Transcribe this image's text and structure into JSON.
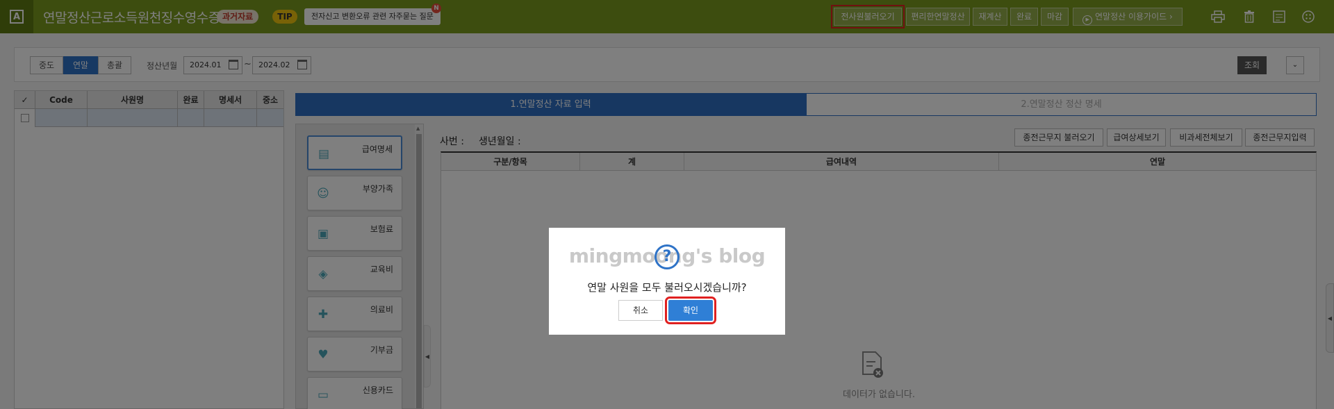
{
  "header": {
    "logo": "A",
    "title": "연말정산근로소득원천징수영수증",
    "past_badge": "과거자료",
    "tip_badge": "TIP",
    "tip_text": "전자신고 변환오류 관련 자주묻는 질문",
    "new_badge": "N",
    "buttons": {
      "load_all": "전사원불러오기",
      "simple_settlement": "편리한연말정산",
      "recalc": "재계산",
      "complete": "완료",
      "close": "마감",
      "guide": "연말정산 이용가이드"
    },
    "icons": [
      "print-icon",
      "trash-icon",
      "spreadsheet-icon",
      "menu-grid-icon"
    ]
  },
  "filter": {
    "tabs": [
      "중도",
      "연말",
      "총괄"
    ],
    "active_tab": "연말",
    "period_label": "정산년월",
    "date_from": "2024.01",
    "date_to": "2024.02",
    "tilde": "~",
    "search_label": "조회",
    "expand_glyph": "⌄"
  },
  "employee_table": {
    "columns": [
      "✓",
      "Code",
      "사원명",
      "완료",
      "명세서",
      "중소"
    ]
  },
  "tabs": {
    "input": "1.연말정산 자료 입력",
    "detail": "2.연말정산 정산 명세"
  },
  "side_menu": [
    {
      "label": "급여명세",
      "icon": "document-icon"
    },
    {
      "label": "부양가족",
      "icon": "family-icon"
    },
    {
      "label": "보험료",
      "icon": "insurance-icon"
    },
    {
      "label": "교육비",
      "icon": "graduation-cap-icon"
    },
    {
      "label": "의료비",
      "icon": "medical-kit-icon"
    },
    {
      "label": "기부금",
      "icon": "donation-hand-icon"
    },
    {
      "label": "신용카드",
      "icon": "credit-card-icon"
    }
  ],
  "employee_info": {
    "employee_no_label": "사번 :",
    "birth_label": "생년월일 :"
  },
  "action_buttons": {
    "prev_load": "종전근무지 불러오기",
    "salary_detail": "급여상세보기",
    "nontax_all": "비과세전체보기",
    "prev_input": "종전근무지입력"
  },
  "grid": {
    "columns": [
      "구분/항목",
      "계",
      "급여내역",
      "연말"
    ],
    "empty_text": "데이터가 없습니다."
  },
  "dialog": {
    "watermark": "mingmoong's blog",
    "message": "연말 사원을 모두 불러오시겠습니까?",
    "cancel": "취소",
    "confirm": "확인"
  },
  "colors": {
    "header": "#7a9a1e",
    "primary": "#2f73c7",
    "highlight": "#e02020"
  }
}
